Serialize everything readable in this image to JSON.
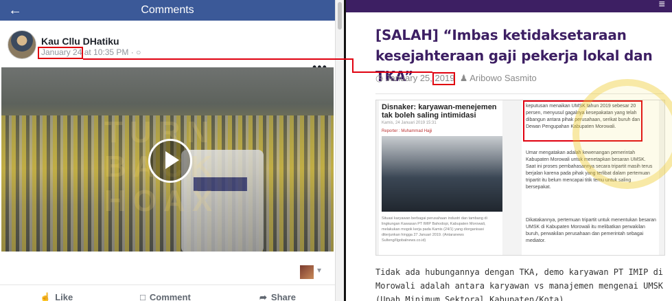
{
  "facebook": {
    "header_title": "Comments",
    "back_icon": "arrow-left-icon",
    "author_name": "Kau Cllu DHatiku",
    "post_date": "January 24",
    "post_time": "at 10:35 PM",
    "privacy_separator": "·",
    "privacy_icon": "globe-icon",
    "more_label": "•••",
    "play_icon": "play-icon",
    "watermark": "TURN BACK HOAX",
    "actions": {
      "like": "Like",
      "comment": "Comment",
      "share": "Share"
    },
    "reaction_caret": "▾"
  },
  "article": {
    "menu_icon": "≡",
    "title": "[SALAH] “Imbas ketidaksetaraan kesejahteraan gaji pekerja lokal dan TKA”",
    "date_icon": "clock-icon",
    "date": "January 25,",
    "date_year": "2019",
    "author_icon": "user-icon",
    "author": "Aribowo Sasmito",
    "embed": {
      "headline": "Disnaker: karyawan-menejemen tak boleh saling intimidasi",
      "date_line": "Kamis, 24 Januari 2019 15:31",
      "reporter": "Reporter : Muhammad Hajji",
      "photo_caption": "Situasi karyawan berbagai perusahaan industri dan tambang di lingkungan Kawasan PT IMIP Bahodopi, Kabupaten Morowali, melakukan mogok kerja pada Kamis (24/1) yang diorganisasi diterjunkan hingga 27 Januari 2019. (Antaranews Sulteng/Ilgobalnews.co.id)",
      "highlight_text": "keputusan menaikan UMSK tahun 2019 sebesar 20 persen, menyusul gagalnya kesepakatan yang telah dibangun antara pihak perusahaan, serikat buruh dan Dewan Pengupahan Kabupaten Morowali.",
      "body_para1": "Umar mengatakan adalah kewenangan pemerintah Kabupaten Morowali untuk menetapkan besaran UMSK. Saat ini proses pembahasannya secara tripartit masih terus berjalan karena pada pihak yang terlibat dalam pertemuan tripartit itu belum mencapai titik temu untuk saling bersepakat.",
      "body_para2": "Dikatakannya, pertemuan tripartit untuk menentukan besaran UMSK di Kabupaten Morowali itu melibatkan perwakilan buruh, perwakilan perusahaan dan pemerintah sebagai mediator."
    },
    "body": "Tidak ada hubungannya dengan TKA, demo karyawan PT IMIP di Morowali adalah antara karyawan vs manajemen mengenai UMSK (Upah Minimum Sektoral Kabupaten/Kota)."
  },
  "colors": {
    "facebook_blue": "#3b5998",
    "article_purple": "#3d1f63",
    "annotation_red": "#e0000f"
  }
}
